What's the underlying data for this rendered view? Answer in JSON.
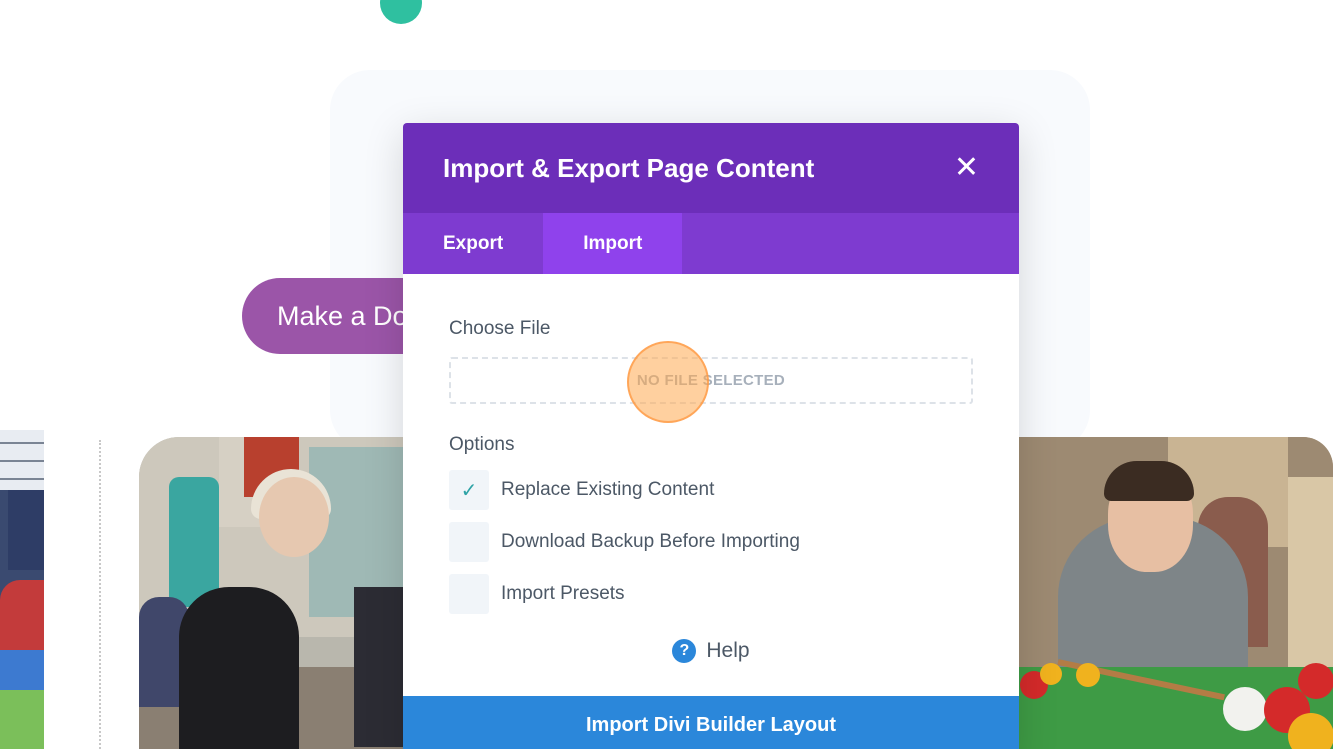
{
  "background": {
    "donate_button_label": "Make a Donation"
  },
  "modal": {
    "title": "Import & Export Page Content",
    "close_icon": "close-icon",
    "tabs": [
      {
        "label": "Export",
        "active": false
      },
      {
        "label": "Import",
        "active": true
      }
    ],
    "choose_file_label": "Choose File",
    "file_drop_text": "NO FILE SELECTED",
    "options_label": "Options",
    "options": [
      {
        "label": "Replace Existing Content",
        "checked": true
      },
      {
        "label": "Download Backup Before Importing",
        "checked": false
      },
      {
        "label": "Import Presets",
        "checked": false
      }
    ],
    "help_label": "Help",
    "submit_label": "Import Divi Builder Layout"
  },
  "colors": {
    "header": "#6c2eb9",
    "tabs_bar": "#7e3bd0",
    "tab_active": "#8f42ec",
    "primary_button": "#2b87da",
    "check": "#2ea3a6",
    "donate_button": "#9b55a8"
  }
}
